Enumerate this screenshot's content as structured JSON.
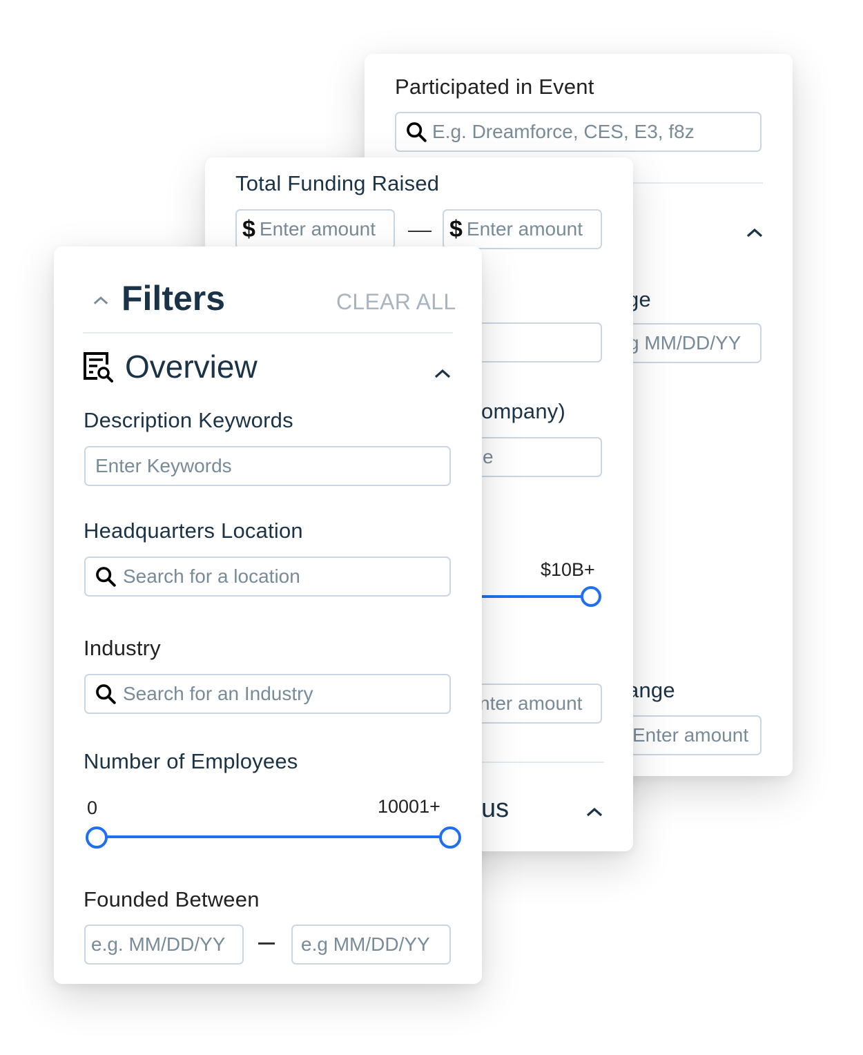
{
  "back_panel": {
    "event": {
      "label": "Participated in Event",
      "placeholder": "E.g. Dreamforce, CES, E3, f8z"
    },
    "date_range": {
      "label_partial": "ge",
      "placeholder_partial": "g MM/DD/YY"
    },
    "amount_range": {
      "label_partial": "ange",
      "placeholder_partial": "Enter amount"
    }
  },
  "middle_panel": {
    "total_funding": {
      "label": "Total Funding Raised",
      "min_placeholder": "Enter amount",
      "max_placeholder": "Enter amount",
      "currency_symbol": "$"
    },
    "company_label_partial": "ompany)",
    "company_placeholder_partial": "e",
    "slider_max_label": "$10B+",
    "amount_placeholder_partial": "nter amount",
    "section_partial": "us"
  },
  "filters_panel": {
    "title": "Filters",
    "clear_all": "CLEAR ALL",
    "overview": {
      "title": "Overview",
      "icon": "document-search-icon"
    },
    "description_keywords": {
      "label": "Description Keywords",
      "placeholder": "Enter Keywords"
    },
    "headquarters_location": {
      "label": "Headquarters Location",
      "placeholder": "Search for a location"
    },
    "industry": {
      "label": "Industry",
      "placeholder": "Search for an Industry"
    },
    "number_of_employees": {
      "label": "Number of Employees",
      "min_label": "0",
      "max_label": "10001+",
      "range_min_fraction": 0,
      "range_max_fraction": 1
    },
    "founded_between": {
      "label": "Founded Between",
      "start_placeholder": "e.g. MM/DD/YY",
      "end_placeholder": "e.g MM/DD/YY"
    }
  },
  "colors": {
    "accent": "#1f6ff0",
    "heading": "#1b3346",
    "placeholder": "#778b99",
    "clear_all": "#a8b4c0",
    "border": "#c8d6e3"
  }
}
